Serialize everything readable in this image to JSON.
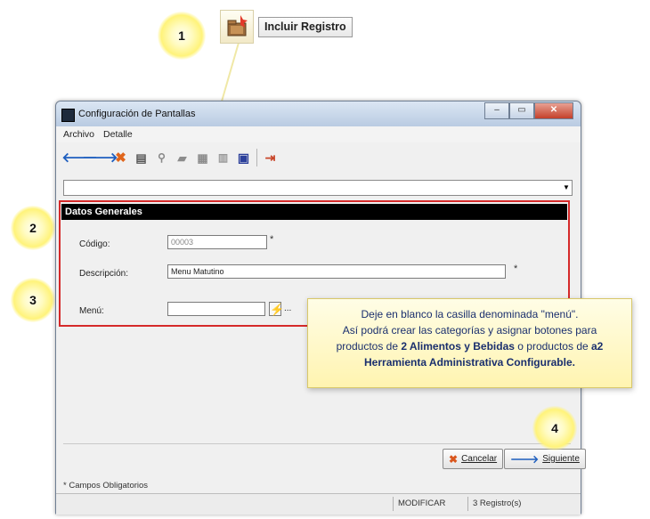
{
  "callout": {
    "step1": "1",
    "step2": "2",
    "step3": "3",
    "step4": "4",
    "include_label": "Incluir Registro"
  },
  "window": {
    "title": "Configuración de Pantallas",
    "title_icon": "app-icon",
    "controls": [
      "minimize",
      "maximize",
      "close"
    ]
  },
  "menu": {
    "items": [
      "Archivo",
      "Detalle"
    ]
  },
  "toolbar": {
    "icons": [
      "back-arrow",
      "forward-arrow",
      "delete-x",
      "print",
      "search",
      "new-record",
      "edit",
      "trash",
      "save",
      "exit-door"
    ]
  },
  "form": {
    "section_title": "Datos Generales",
    "code_label": "Código:",
    "code_value": "00003",
    "description_label": "Descripción:",
    "description_value": "Menu Matutino",
    "menu_label": "Menú:",
    "menu_value": "",
    "required_mark": "*",
    "lookup_dots": "..."
  },
  "tooltip": {
    "line1": "Deje en blanco la casilla denominada \"menú\".",
    "line2": "Así podrá crear las categorías y asignar botones para",
    "line3_pre": "productos de ",
    "line3_bold1": "2 Alimentos y Bebidas",
    "line3_mid": " o productos de ",
    "line3_bold2": "a2",
    "line4_bold": "Herramienta Administrativa Configurable."
  },
  "buttons": {
    "cancel": "Cancelar",
    "next": "Siguiente"
  },
  "footer": {
    "required_note": "* Campos Obligatorios",
    "mode": "MODIFICAR",
    "records": "3 Registro(s)"
  },
  "colors": {
    "highlight_border": "#d52a2a",
    "section_bar": "#000000",
    "tooltip_bg": "#fff6c0",
    "tooltip_text": "#1a2f6e",
    "marker_glow": "#fff37a"
  }
}
